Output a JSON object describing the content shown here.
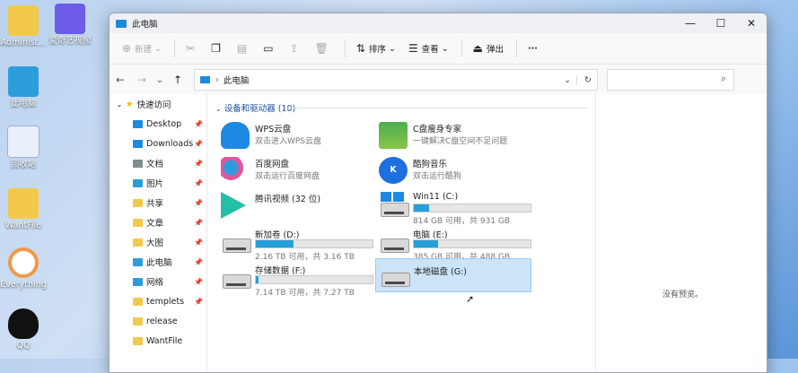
{
  "desktop": {
    "icons": [
      {
        "label": "Administ...",
        "color": "#f2c94c"
      },
      {
        "label": "爱奇艺视频",
        "color": "#6c5ce7"
      },
      {
        "label": "此电脑",
        "color": "#2d9cdb"
      },
      {
        "label": "回收站",
        "color": "#e8f1fb"
      },
      {
        "label": "WantFile",
        "color": "#f2c94c"
      },
      {
        "label": "Everything",
        "color": "#f2994a"
      },
      {
        "label": "QQ",
        "color": "#111111"
      }
    ]
  },
  "window": {
    "title": "此电脑",
    "caption": {
      "minimize": "—",
      "maximize": "☐",
      "close": "✕"
    },
    "toolbar": {
      "new": "新建",
      "sort": "排序",
      "view": "查看",
      "eject": "弹出",
      "more": "···"
    },
    "address": {
      "path": "此电脑",
      "separator": "›"
    },
    "nav": {
      "back": "←",
      "forward": "→",
      "recent": "⌄",
      "up": "↑",
      "refresh": "↻",
      "dropdown": "⌄"
    },
    "search": {
      "placeholder": ""
    },
    "sidebar": {
      "quick_access": "快速访问",
      "items": [
        {
          "label": "Desktop",
          "color": "#1e88e5"
        },
        {
          "label": "Downloads",
          "color": "#1e88e5"
        },
        {
          "label": "文档",
          "color": "#7f8c8d"
        },
        {
          "label": "图片",
          "color": "#2d9cdb"
        },
        {
          "label": "共享",
          "color": "#f2c94c"
        },
        {
          "label": "文章",
          "color": "#f2c94c"
        },
        {
          "label": "大图",
          "color": "#f2c94c"
        },
        {
          "label": "此电脑",
          "color": "#2d9cdb"
        },
        {
          "label": "网络",
          "color": "#2d9cdb"
        },
        {
          "label": "templets",
          "color": "#f2c94c"
        },
        {
          "label": "release",
          "color": "#f2c94c"
        },
        {
          "label": "WantFile",
          "color": "#f2c94c"
        }
      ]
    },
    "content": {
      "group_label": "设备和驱动器 (10)",
      "apps": [
        {
          "name": "WPS云盘",
          "sub": "双击进入WPS云盘",
          "color": "#1e88e5"
        },
        {
          "name": "C盘瘦身专家",
          "sub": "一键解决C盘空间不足问题",
          "color": "#4caf50"
        },
        {
          "name": "百度网盘",
          "sub": "双击运行百度网盘",
          "color": "#2d9cdb"
        },
        {
          "name": "酷狗音乐",
          "sub": "双击运行酷狗",
          "color": "#1e6fe0"
        },
        {
          "name": "腾讯视频 (32 位)",
          "sub": "",
          "color": "#22c1a5"
        }
      ],
      "drives": [
        {
          "name": "Win11 (C:)",
          "sub": "814 GB 可用，共 931 GB",
          "fill": 0.13
        },
        {
          "name": "新加卷 (D:)",
          "sub": "2.16 TB 可用，共 3.16 TB",
          "fill": 0.32
        },
        {
          "name": "电脑 (E:)",
          "sub": "385 GB 可用，共 488 GB",
          "fill": 0.21
        },
        {
          "name": "存储数据 (F:)",
          "sub": "7.14 TB 可用，共 7.27 TB",
          "fill": 0.02
        },
        {
          "name": "本地磁盘 (G:)",
          "sub": "",
          "fill": 0
        }
      ]
    },
    "preview": {
      "text": "没有预览。"
    }
  }
}
